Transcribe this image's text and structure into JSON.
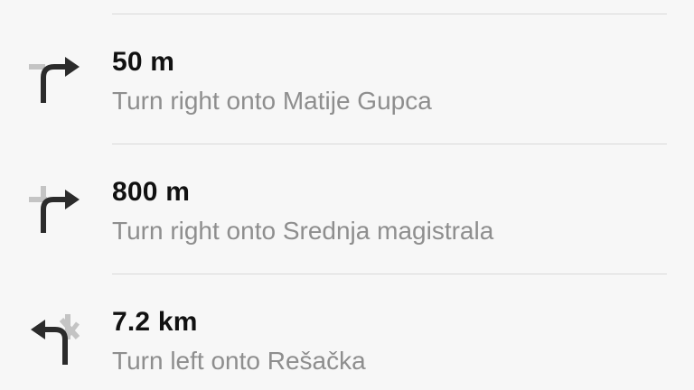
{
  "directions": {
    "steps": [
      {
        "distance": "50 m",
        "instruction": "Turn right onto Matije Gupca",
        "maneuver_icon": "turn-right-icon"
      },
      {
        "distance": "800 m",
        "instruction": "Turn right onto Srednja magistrala",
        "maneuver_icon": "turn-right-icon"
      },
      {
        "distance": "7.2 km",
        "instruction": "Turn left onto Rešačka",
        "maneuver_icon": "turn-left-icon"
      }
    ]
  },
  "colors": {
    "background": "#f7f7f7",
    "distance_text": "#111111",
    "instruction_text": "#8e8e8e",
    "arrow_dark": "#2b2b2b",
    "arrow_light": "#c4c4c4",
    "divider": "#d9d9d9"
  }
}
